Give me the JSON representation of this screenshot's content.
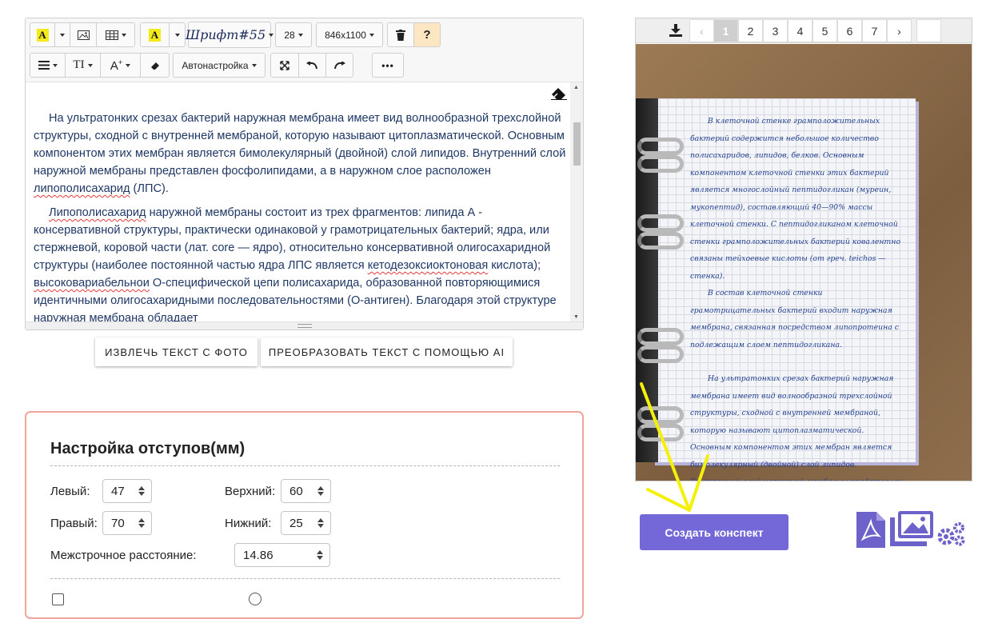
{
  "toolbar": {
    "font_name": "Шрифт#55",
    "font_size": "28",
    "page_size": "846x1100",
    "help_label": "?",
    "autosetup_label": "Автонастройка",
    "more_label": "•••"
  },
  "editor": {
    "paragraphs": [
      {
        "text_a": "На ультратонких срезах бактерий наружная мембрана имеет вид волнообразной трехслойной структуры, сходной с внутренней мембраной, которую называют цитоплазматической. Основным компонентом этих мембран является бимолекулярный (двойной) слой липидов. Внутренний слой наружной мембраны представлен фосфолипидами, а в наружном слое расположен ",
        "marked_a": "липополисахарид",
        "text_b": " (ЛПС)."
      },
      {
        "marked_a": "Липополисахарид",
        "text_a": " наружной мембраны состоит из трех фрагментов: липида А - консервативной структуры, практически одинаковой у грамотрицательных бактерий; ядра, или стержневой, коровой части (лат. core — ядро), относительно консервативной олигосахаридной структуры (наиболее постоянной частью ядра ЛПС является ",
        "marked_b": "кетодезоксиоктоновая",
        "text_b": " кислота); ",
        "marked_c": "высоковариабельнои",
        "text_c": " О-специфической цепи полисахарида, образованной повторяющимися идентичными олигосахаридными последовательностями (О-антиген). Благодаря этой структуре наружная мембрана обладает"
      }
    ]
  },
  "actions": {
    "extract_label": "ИЗВЛЕЧЬ ТЕКСТ С ФОТО",
    "ai_label": "ПРЕОБРАЗОВАТЬ ТЕКСТ С ПОМОЩЬЮ AI"
  },
  "margins": {
    "title": "Настройка отступов(мм)",
    "left_label": "Левый:",
    "left_value": "47",
    "top_label": "Верхний:",
    "top_value": "60",
    "right_label": "Правый:",
    "right_value": "70",
    "bottom_label": "Нижний:",
    "bottom_value": "25",
    "line_spacing_label": "Межстрочное расстояние:",
    "line_spacing_value": "14.86"
  },
  "pager": {
    "prev": "‹",
    "pages": [
      "1",
      "2",
      "3",
      "4",
      "5",
      "6",
      "7"
    ],
    "active_page": "1",
    "next": "›"
  },
  "preview": {
    "handwriting": [
      "В клеточной стенке грамположительных бактерий содержится небольшое количество полисахаридов, липидов, белков. Основным компонентом клеточной стенки этих бактерий является многослойный пептидогликан (муреин, мукопептид), составляющий 40—90% массы клеточной стенки. С пептидогликаном клеточной стенки грамположительных бактерий ковалентно связаны тейхоевые кислоты (от греч. teichos — стенка).",
      "В состав клеточной стенки грамотрицательных бактерий входит наружная мембрана, связанная посредством липопротеина с подлежащим слоем пептидогликана.",
      "На ультратонких срезах бактерий наружная мембрана имеет вид волнообразной трехслойной структуры, сходной с внутренней мембраной, которую называют цитоплазматической. Основным компонентом этих мембран является бимолекулярный (двойной) слой липидов. Внутренний слой наружной мембраны представлен фосфолипидами, а в наружном слое расположен липополи-"
    ]
  },
  "create_button_label": "Создать конспект",
  "colors": {
    "accent": "#7467d8",
    "panel_border": "#f0a59a",
    "arrow": "#f5f00a",
    "editor_text": "#1f3864"
  }
}
